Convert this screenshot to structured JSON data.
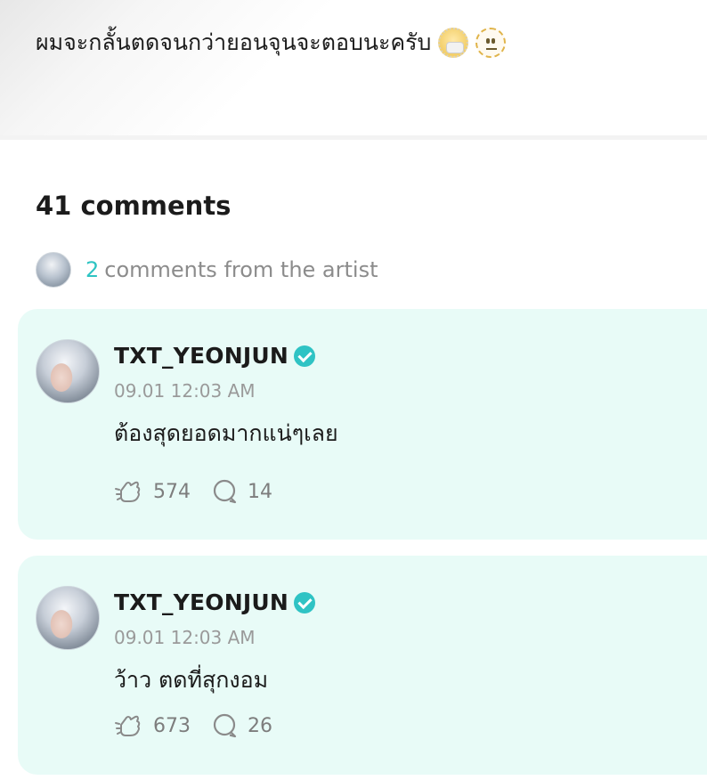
{
  "post": {
    "text": "ผมจะกลั้นตดจนกว่ายอนจุนจะตอบนะครับ",
    "emojis": [
      "face-with-medical-mask",
      "dotted-line-face"
    ]
  },
  "comments_header": {
    "total": "41 comments",
    "artist_count": "2",
    "artist_label": "comments from the artist"
  },
  "comments": [
    {
      "author": "TXT_YEONJUN",
      "time": "09.01 12:03 AM",
      "text": "ต้องสุดยอดมากแน่ๆเลย",
      "likes": "574",
      "replies": "14"
    },
    {
      "author": "TXT_YEONJUN",
      "time": "09.01 12:03 AM",
      "text": "ว้าว ตดที่สุกงอม",
      "likes": "673",
      "replies": "26"
    }
  ],
  "colors": {
    "accent": "#2ec4c3",
    "artist_card_bg": "#e8fbf7",
    "muted_text": "#8c8c8c"
  }
}
